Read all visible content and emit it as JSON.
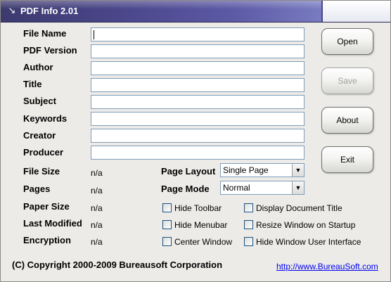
{
  "window": {
    "title": "PDF Info 2.01",
    "icon": "pdf-app-icon"
  },
  "fields": [
    {
      "label": "File Name",
      "value": ""
    },
    {
      "label": "PDF Version",
      "value": ""
    },
    {
      "label": "Author",
      "value": ""
    },
    {
      "label": "Title",
      "value": ""
    },
    {
      "label": "Subject",
      "value": ""
    },
    {
      "label": "Keywords",
      "value": ""
    },
    {
      "label": "Creator",
      "value": ""
    },
    {
      "label": "Producer",
      "value": ""
    }
  ],
  "buttons": {
    "open": "Open",
    "save": "Save",
    "about": "About",
    "exit": "Exit"
  },
  "info": [
    {
      "label": "File Size",
      "value": "n/a"
    },
    {
      "label": "Pages",
      "value": "n/a"
    },
    {
      "label": "Paper Size",
      "value": "n/a"
    },
    {
      "label": "Last Modified",
      "value": "n/a"
    },
    {
      "label": "Encryption",
      "value": "n/a"
    }
  ],
  "page_layout": {
    "label": "Page Layout",
    "value": "Single Page"
  },
  "page_mode": {
    "label": "Page Mode",
    "value": "Normal"
  },
  "checkboxes": {
    "hide_toolbar": {
      "label": "Hide Toolbar",
      "checked": false
    },
    "hide_menubar": {
      "label": "Hide Menubar",
      "checked": false
    },
    "center_window": {
      "label": "Center Window",
      "checked": false
    },
    "display_document_title": {
      "label": "Display Document Title",
      "checked": false
    },
    "resize_window_on_startup": {
      "label": "Resize Window on Startup",
      "checked": false
    },
    "hide_window_user_interface": {
      "label": "Hide Window User Interface",
      "checked": false
    }
  },
  "footer": {
    "copyright": "(C) Copyright 2000-2009 Bureausoft Corporation",
    "link": "http://www.BureauSoft.com"
  }
}
